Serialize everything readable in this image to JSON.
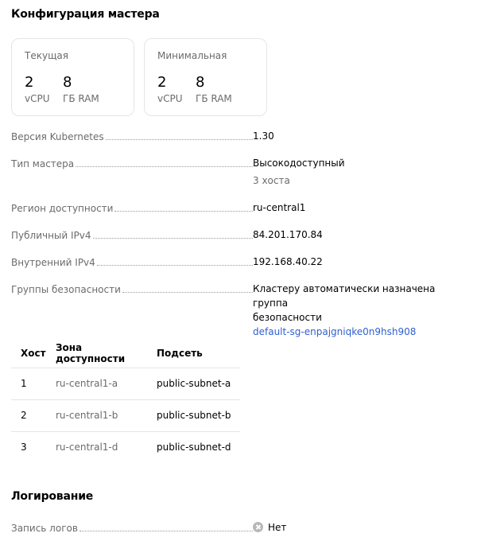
{
  "master_config": {
    "title": "Конфигурация мастера",
    "current": {
      "title": "Текущая",
      "vcpu_value": "2",
      "vcpu_unit": "vCPU",
      "ram_value": "8",
      "ram_unit": "ГБ RAM"
    },
    "minimal": {
      "title": "Минимальная",
      "vcpu_value": "2",
      "vcpu_unit": "vCPU",
      "ram_value": "8",
      "ram_unit": "ГБ RAM"
    }
  },
  "details": {
    "k8s_version": {
      "label": "Версия Kubernetes",
      "value": "1.30"
    },
    "master_type": {
      "label": "Тип мастера",
      "value": "Высокодоступный",
      "sub": "3 хоста"
    },
    "region": {
      "label": "Регион доступности",
      "value": "ru-central1"
    },
    "public_ip": {
      "label": "Публичный IPv4",
      "value": "84.201.170.84"
    },
    "internal_ip": {
      "label": "Внутренний IPv4",
      "value": "192.168.40.22"
    },
    "security_groups": {
      "label": "Группы безопасности",
      "value_line1": "Кластеру автоматически назначена группа",
      "value_line2": "безопасности",
      "link": "default-sg-enpajgniqke0n9hsh908"
    }
  },
  "hosts_table": {
    "columns": [
      "Хост",
      "Зона доступности",
      "Подсеть"
    ],
    "rows": [
      {
        "host": "1",
        "zone": "ru-central1-a",
        "subnet": "public-subnet-a"
      },
      {
        "host": "2",
        "zone": "ru-central1-b",
        "subnet": "public-subnet-b"
      },
      {
        "host": "3",
        "zone": "ru-central1-d",
        "subnet": "public-subnet-d"
      }
    ]
  },
  "logging": {
    "title": "Логирование",
    "log_write": {
      "label": "Запись логов",
      "value": "Нет",
      "icon": "x-circle-icon"
    }
  }
}
